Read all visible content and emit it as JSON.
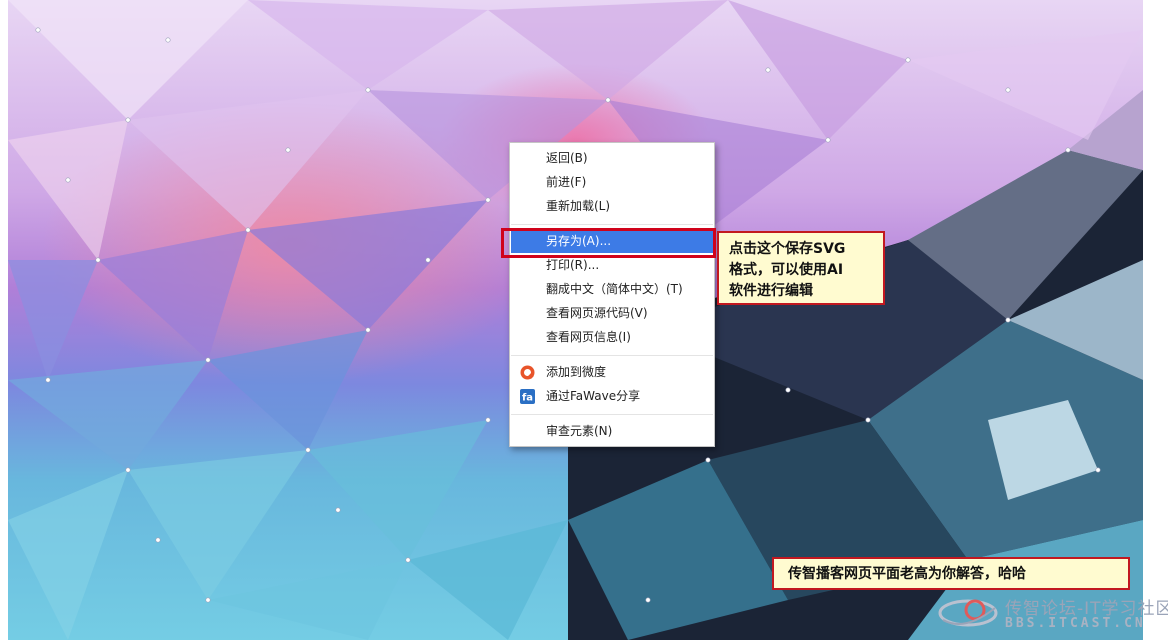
{
  "context_menu": {
    "items": [
      {
        "label": "返回(B)"
      },
      {
        "label": "前进(F)"
      },
      {
        "label": "重新加载(L)"
      },
      {
        "label": "另存为(A)..."
      },
      {
        "label": "打印(R)..."
      },
      {
        "label": "翻成中文（简体中文）(T)"
      },
      {
        "label": "查看网页源代码(V)"
      },
      {
        "label": "查看网页信息(I)"
      },
      {
        "label": "添加到微度",
        "icon": "weidu-icon"
      },
      {
        "label": "通过FaWave分享",
        "icon": "fawave-icon"
      },
      {
        "label": "审查元素(N)"
      }
    ],
    "highlight_color": "#3d7be6"
  },
  "annotations": {
    "svg_note": {
      "line1": "点击这个保存SVG",
      "line2": "格式，可以使用AI",
      "line3": "软件进行编辑"
    },
    "author_note": "传智播客网页平面老高为你解答，哈哈",
    "highlight_border_color": "#d0021b"
  },
  "watermark": {
    "line1": "传智论坛-IT学习社区",
    "line2": "BBS.ITCAST.CN"
  },
  "background": {
    "style": "low-poly triangles",
    "colors": [
      "#c9a6e3",
      "#e98fb6",
      "#7d8fe0",
      "#6fc7de",
      "#1c2438"
    ]
  }
}
